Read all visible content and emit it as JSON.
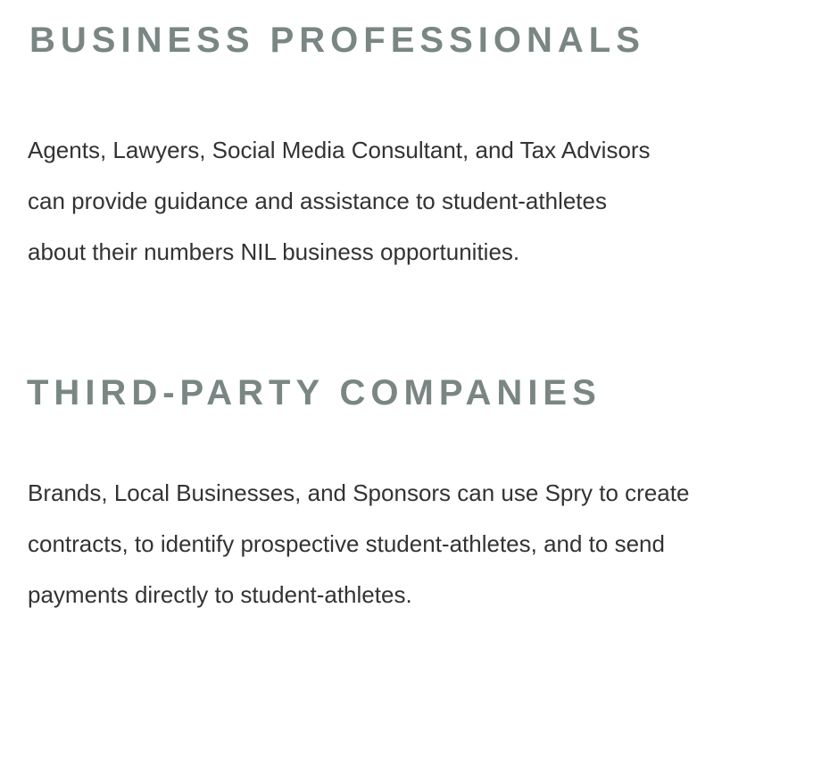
{
  "sections": [
    {
      "heading": "BUSINESS PROFESSIONALS",
      "lines": [
        "Agents, Lawyers, Social Media Consultant, and Tax Advisors",
        "can provide guidance and assistance to student-athletes",
        "about their numbers NIL business opportunities."
      ]
    },
    {
      "heading": "THIRD-PARTY COMPANIES",
      "lines": [
        "Brands, Local Businesses, and Sponsors can use Spry to create",
        "contracts,  to identify prospective student-athletes, and to send",
        "payments directly to student-athletes."
      ]
    }
  ],
  "colors": {
    "heading": "#7a8683",
    "body_text": "#333333",
    "background": "#ffffff"
  }
}
